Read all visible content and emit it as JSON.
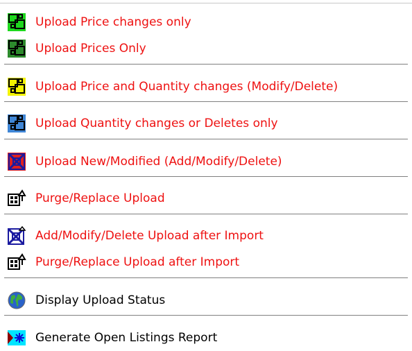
{
  "menu": {
    "items": [
      {
        "label": "Upload Price changes only",
        "icon": "upload-price-changes-icon",
        "color": "#ee1111",
        "icon_fill": "#1ed81e"
      },
      {
        "label": "Upload Prices Only",
        "icon": "upload-prices-icon",
        "color": "#ee1111",
        "icon_fill": "#2d8a2d"
      },
      {
        "label": "Upload Price and Quantity changes (Modify/Delete)",
        "icon": "upload-price-quantity-icon",
        "color": "#ee1111",
        "icon_fill": "#f3f300"
      },
      {
        "label": "Upload Quantity changes or Deletes only",
        "icon": "upload-quantity-icon",
        "color": "#ee1111",
        "icon_fill": "#3f86d6"
      },
      {
        "label": "Upload New/Modified (Add/Modify/Delete)",
        "icon": "upload-new-modified-icon",
        "color": "#ee1111",
        "icon_fill": "#e02020"
      },
      {
        "label": "Purge/Replace Upload",
        "icon": "purge-replace-icon",
        "color": "#ee1111",
        "icon_fill": "#000000"
      },
      {
        "label": "Add/Modify/Delete Upload after Import",
        "icon": "add-modify-delete-import-icon",
        "color": "#ee1111",
        "icon_fill": "#1a1aa0"
      },
      {
        "label": "Purge/Replace Upload after Import",
        "icon": "purge-replace-import-icon",
        "color": "#ee1111",
        "icon_fill": "#000000"
      },
      {
        "label": "Display Upload Status",
        "icon": "globe-icon",
        "color": "#000000",
        "icon_fill": "#2a62c9"
      },
      {
        "label": "Generate Open Listings Report",
        "icon": "report-icon",
        "color": "#000000",
        "icon_fill": "#00e5ff"
      }
    ]
  }
}
